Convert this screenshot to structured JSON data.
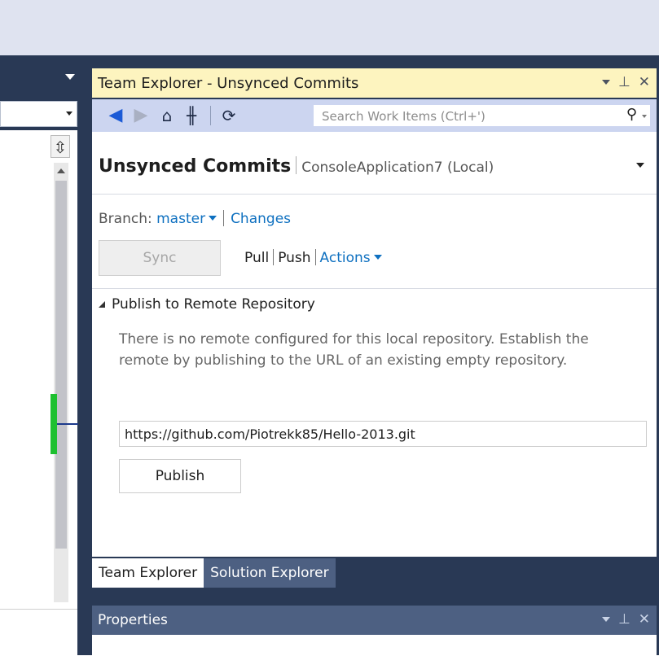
{
  "colors": {
    "frame": "#293955",
    "active_title": "#fdf4bf",
    "toolbar": "#ccd5f0",
    "link": "#0e70c0",
    "inactive_tab": "#4d6082",
    "git_marker": "#1ec030"
  },
  "team_explorer": {
    "title": "Team Explorer - Unsynced Commits",
    "title_buttons": [
      "dropdown-icon",
      "pin-icon",
      "close-icon"
    ],
    "toolbar": {
      "icons": [
        "back-icon",
        "forward-icon",
        "home-icon",
        "connect-icon",
        "refresh-icon"
      ],
      "search_placeholder": "Search Work Items (Ctrl+')"
    },
    "page_title": "Unsynced Commits",
    "page_context": "ConsoleApplication7 (Local)",
    "branch_label": "Branch:",
    "branch_value": "master",
    "changes_link": "Changes",
    "sync_label": "Sync",
    "pull_label": "Pull",
    "push_label": "Push",
    "actions_label": "Actions",
    "section_title": "Publish to Remote Repository",
    "section_desc": "There is no remote configured for this local repository. Establish the remote by publishing to the URL of an existing empty repository.",
    "url_value": "https://github.com/Piotrekk85/Hello-2013.git",
    "publish_label": "Publish"
  },
  "tabs": [
    {
      "label": "Team Explorer",
      "active": true
    },
    {
      "label": "Solution Explorer",
      "active": false
    }
  ],
  "properties": {
    "title": "Properties"
  }
}
